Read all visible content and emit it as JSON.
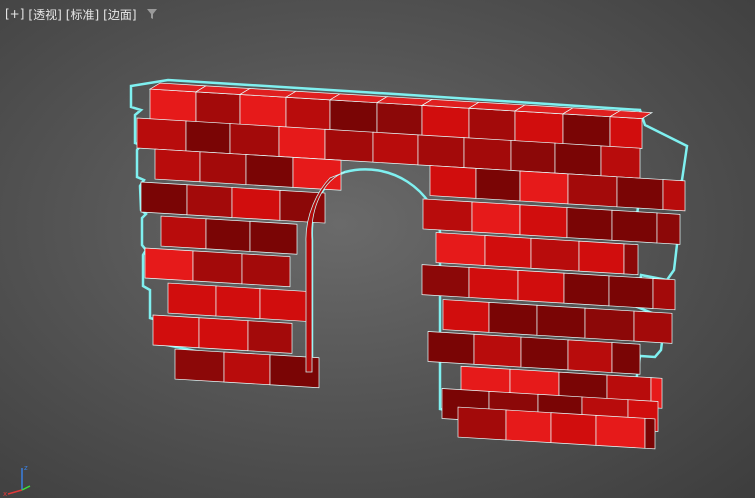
{
  "viewport": {
    "labels": [
      "[+]",
      "[透视]",
      "[标准]",
      "[边面]"
    ],
    "filter_icon": "filter-icon",
    "background": "#555555",
    "selection_color": "#7ff0f0",
    "brick_colors": [
      "#d10d0d",
      "#a30a0a",
      "#7a0505",
      "#e61a1a",
      "#8c0808",
      "#b80c0c"
    ],
    "gizmo_axes": [
      "x",
      "y",
      "z"
    ]
  }
}
